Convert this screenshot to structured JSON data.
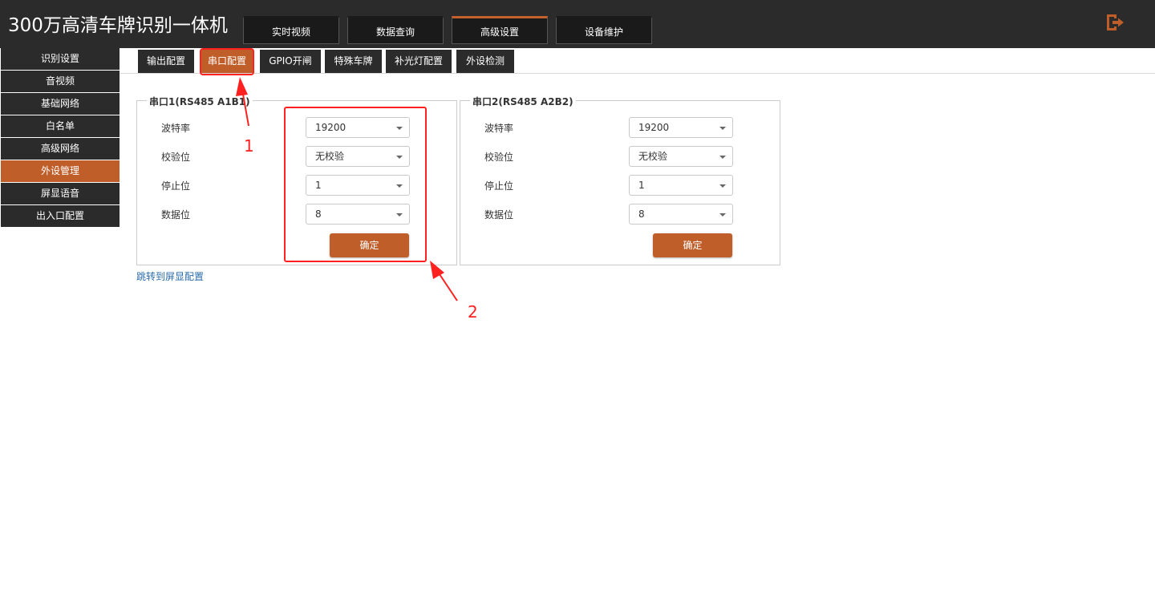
{
  "app": {
    "title": "300万高清车牌识别一体机"
  },
  "top_tabs": [
    {
      "label": "实时视频",
      "active": false
    },
    {
      "label": "数据查询",
      "active": false
    },
    {
      "label": "高级设置",
      "active": true
    },
    {
      "label": "设备维护",
      "active": false
    }
  ],
  "sidebar": {
    "items": [
      {
        "label": "识别设置"
      },
      {
        "label": "音视频"
      },
      {
        "label": "基础网络"
      },
      {
        "label": "白名单"
      },
      {
        "label": "高级网络"
      },
      {
        "label": "外设管理",
        "active": true
      },
      {
        "label": "屏显语音"
      },
      {
        "label": "出入口配置"
      }
    ]
  },
  "sub_tabs": [
    {
      "label": "输出配置"
    },
    {
      "label": "串口配置",
      "active": true
    },
    {
      "label": "GPIO开闸"
    },
    {
      "label": "特殊车牌"
    },
    {
      "label": "补光灯配置"
    },
    {
      "label": "外设检测"
    }
  ],
  "serial1": {
    "title": "串口1(RS485 A1B1)",
    "baud_label": "波特率",
    "baud_value": "19200",
    "parity_label": "校验位",
    "parity_value": "无校验",
    "stop_label": "停止位",
    "stop_value": "1",
    "data_label": "数据位",
    "data_value": "8",
    "confirm": "确定"
  },
  "serial2": {
    "title": "串口2(RS485 A2B2)",
    "baud_label": "波特率",
    "baud_value": "19200",
    "parity_label": "校验位",
    "parity_value": "无校验",
    "stop_label": "停止位",
    "stop_value": "1",
    "data_label": "数据位",
    "data_value": "8",
    "confirm": "确定"
  },
  "jump_link": "跳转到屏显配置",
  "annotations": {
    "n1": "1",
    "n2": "2"
  },
  "colors": {
    "accent": "#c05e2a",
    "header_bg": "#2b2b2b",
    "annotation": "#ff2020"
  },
  "icons": {
    "logout": "logout-icon"
  }
}
